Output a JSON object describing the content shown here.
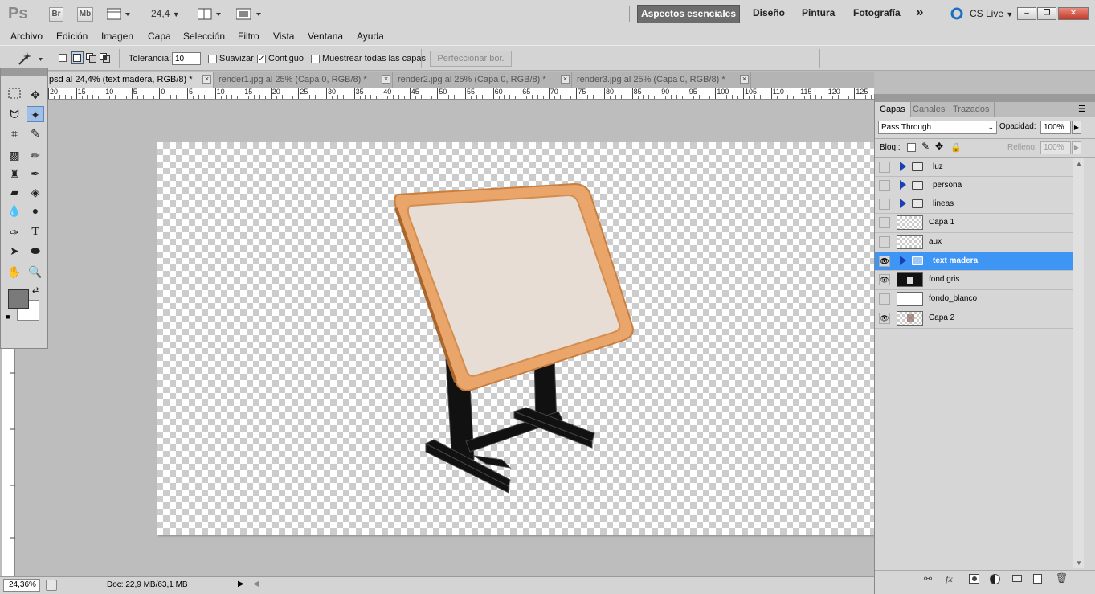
{
  "titlebar": {
    "logo": "Ps",
    "br": "Br",
    "mb": "Mb",
    "zoom": "24,4",
    "workspaces": [
      "Aspectos esenciales",
      "Diseño",
      "Pintura",
      "Fotografía"
    ],
    "more": "»",
    "cslive": "CS Live"
  },
  "menubar": {
    "items": [
      "Archivo",
      "Edición",
      "Imagen",
      "Capa",
      "Selección",
      "Filtro",
      "Vista",
      "Ventana",
      "Ayuda"
    ]
  },
  "options": {
    "tolerance_label": "Tolerancia:",
    "tolerance_value": "10",
    "smooth_label": "Suavizar",
    "contiguous_label": "Contiguo",
    "sample_all_label": "Muestrear todas las capas",
    "refine_label": "Perfeccionar bor.",
    "smooth_checked": false,
    "contiguous_checked": true,
    "sample_all_checked": false
  },
  "tabs": [
    {
      "label": "psd al 24,4% (text madera, RGB/8) *",
      "active": true
    },
    {
      "label": "render1.jpg al 25% (Capa 0, RGB/8) *",
      "active": false
    },
    {
      "label": "render2.jpg al 25% (Capa 0, RGB/8) *",
      "active": false
    },
    {
      "label": "render3.jpg al 25% (Capa 0, RGB/8) *",
      "active": false
    }
  ],
  "tab_close": "×",
  "ruler_h": [
    "20",
    "15",
    "10",
    "5",
    "0",
    "5",
    "10",
    "15",
    "20",
    "25",
    "30",
    "35",
    "40",
    "45",
    "50",
    "55",
    "60",
    "65",
    "70",
    "75",
    "80",
    "85",
    "90",
    "95",
    "100",
    "105",
    "110",
    "115",
    "120",
    "125"
  ],
  "status": {
    "zoom": "24,36%",
    "doc": "Doc: 22,9 MB/63,1 MB"
  },
  "panel": {
    "tabs": [
      "Capas",
      "Canales",
      "Trazados"
    ],
    "blend_mode": "Pass Through",
    "opacity_label": "Opacidad:",
    "opacity_value": "100%",
    "lock_label": "Bloq.:",
    "fill_label": "Relleno:",
    "fill_value": "100%",
    "layers": [
      {
        "name": "luz",
        "type": "group",
        "visible": false,
        "selected": false
      },
      {
        "name": "persona",
        "type": "group",
        "visible": false,
        "selected": false
      },
      {
        "name": "lineas",
        "type": "group",
        "visible": false,
        "selected": false
      },
      {
        "name": "Capa 1",
        "type": "layer",
        "visible": false,
        "selected": false
      },
      {
        "name": "aux",
        "type": "layer",
        "visible": false,
        "selected": false
      },
      {
        "name": "text madera",
        "type": "group",
        "visible": true,
        "selected": true
      },
      {
        "name": "fond gris",
        "type": "layer",
        "visible": true,
        "selected": false
      },
      {
        "name": "fondo_blanco",
        "type": "layer",
        "visible": false,
        "selected": false
      },
      {
        "name": "Capa 2",
        "type": "layer",
        "visible": true,
        "selected": false
      }
    ]
  },
  "colors": {
    "selection": "#3e95f4",
    "frame": "#e9a56a",
    "legs": "#111111"
  }
}
